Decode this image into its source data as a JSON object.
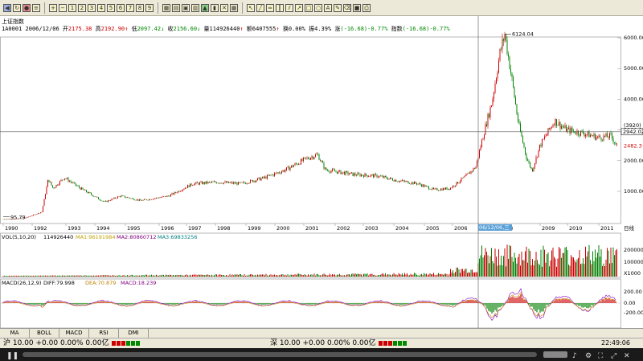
{
  "stock": {
    "name": "上证指数",
    "code": "1A0001",
    "date": "2006/12/06",
    "open_label": "开",
    "open": "2175.38",
    "high_label": "高",
    "high": "2192.90",
    "low_label": "低",
    "low": "2097.42",
    "close_label": "收",
    "close": "2156.60",
    "volume_label": "量",
    "volume": "114926440",
    "amount_label": "额",
    "amount": "6407555",
    "turnover_label": "换",
    "turnover": "0.00%",
    "amplitude_label": "振",
    "amplitude": "4.39%",
    "change_label": "涨",
    "change": "(-16.68)-0.77%",
    "index_change_label": "指数",
    "index_change": "(-16.68)-0.77%"
  },
  "price_axis": [
    "6000.00",
    "5000.00",
    "4000.00",
    "3000.00",
    "2000.00",
    "1000.00"
  ],
  "price_tags": {
    "cursor": "(3920)",
    "cursor_value": "2942.02",
    "last": "2482.3"
  },
  "annotations": {
    "peak": "6124.04",
    "trough": "95.79"
  },
  "years": [
    "1990",
    "1992",
    "1993",
    "1994",
    "1995",
    "1996",
    "1997",
    "1998",
    "1999",
    "2000",
    "2001",
    "2002",
    "2003",
    "2004",
    "2005",
    "2006",
    "08",
    "2009",
    "2010",
    "2011"
  ],
  "cursor_date": "06/12/06,三",
  "period_label": "日线",
  "volume_panel": {
    "title": "VOL(5,10,20)",
    "value": "114926440",
    "ma1": "MA1:96191984",
    "ma2": "MA2:80860712",
    "ma3": "MA3:69833256",
    "axis": [
      "200000",
      "100000"
    ],
    "unit": "X1000"
  },
  "macd_panel": {
    "title": "MACD(26,12,9)",
    "diff": "DIFF:79.998",
    "dea": "DEA:70.879",
    "macd": "MACD:18.239",
    "axis": [
      "200.00",
      "0.00",
      "-200.00"
    ]
  },
  "indicator_tabs": [
    "MA",
    "BOLL",
    "MACD",
    "RSI",
    "DMI"
  ],
  "status_bar": {
    "sh_label": "沪",
    "sh_value": "10.00 +0.00 0.00% 0.00亿",
    "sz_label": "深",
    "sz_value": "10.00 +0.00 0.00% 0.00亿"
  },
  "clock": "22:49:06",
  "colors": {
    "up": "#cc0000",
    "down": "#008000",
    "diff": "#8000c0",
    "dea": "#cc8800"
  }
}
